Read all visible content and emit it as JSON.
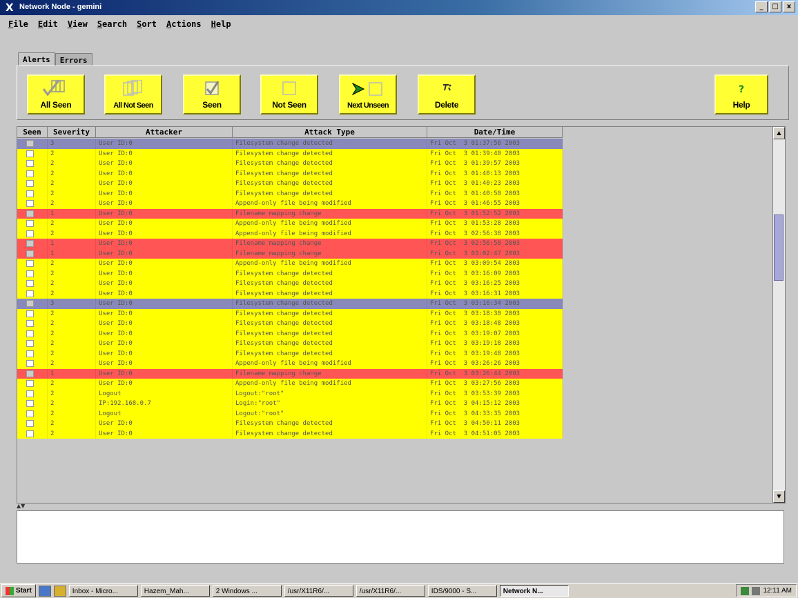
{
  "window": {
    "title": "Network Node - gemini",
    "controls": [
      "_",
      "□",
      "x"
    ]
  },
  "menu": [
    {
      "first": "F",
      "rest": "ile"
    },
    {
      "first": "E",
      "rest": "dit"
    },
    {
      "first": "V",
      "rest": "iew"
    },
    {
      "first": "S",
      "rest": "earch"
    },
    {
      "first": "S",
      "rest": "ort"
    },
    {
      "first": "A",
      "rest": "ctions"
    },
    {
      "first": "H",
      "rest": "elp"
    }
  ],
  "tabs": {
    "alerts": "Alerts",
    "errors": "Errors"
  },
  "toolbar": {
    "all_seen": "All Seen",
    "all_not_seen": "All Not Seen",
    "seen": "Seen",
    "not_seen": "Not Seen",
    "next_unseen": "Next Unseen",
    "delete": "Delete",
    "help": "Help"
  },
  "columns": {
    "seen": "Seen",
    "severity": "Severity",
    "attacker": "Attacker",
    "attack_type": "Attack Type",
    "datetime": "Date/Time"
  },
  "rows": [
    {
      "sev": "3",
      "attacker": "User ID:0",
      "type": "Filesystem change detected",
      "time": "Fri Oct  3 01:37:56 2003"
    },
    {
      "sev": "2",
      "attacker": "User ID:0",
      "type": "Filesystem change detected",
      "time": "Fri Oct  3 01:39:40 2003"
    },
    {
      "sev": "2",
      "attacker": "User ID:0",
      "type": "Filesystem change detected",
      "time": "Fri Oct  3 01:39:57 2003"
    },
    {
      "sev": "2",
      "attacker": "User ID:0",
      "type": "Filesystem change detected",
      "time": "Fri Oct  3 01:40:13 2003"
    },
    {
      "sev": "2",
      "attacker": "User ID:0",
      "type": "Filesystem change detected",
      "time": "Fri Oct  3 01:40:23 2003"
    },
    {
      "sev": "2",
      "attacker": "User ID:0",
      "type": "Filesystem change detected",
      "time": "Fri Oct  3 01:40:50 2003"
    },
    {
      "sev": "2",
      "attacker": "User ID:0",
      "type": "Append-only file being modified",
      "time": "Fri Oct  3 01:46:55 2003"
    },
    {
      "sev": "1",
      "attacker": "User ID:0",
      "type": "Filename mapping change",
      "time": "Fri Oct  3 01:52:52 2003"
    },
    {
      "sev": "2",
      "attacker": "User ID:0",
      "type": "Append-only file being modified",
      "time": "Fri Oct  3 01:53:28 2003"
    },
    {
      "sev": "2",
      "attacker": "User ID:0",
      "type": "Append-only file being modified",
      "time": "Fri Oct  3 02:56:38 2003"
    },
    {
      "sev": "1",
      "attacker": "User ID:0",
      "type": "Filename mapping change",
      "time": "Fri Oct  3 02:56:58 2003"
    },
    {
      "sev": "1",
      "attacker": "User ID:0",
      "type": "Filename mapping change",
      "time": "Fri Oct  3 03:02:47 2003"
    },
    {
      "sev": "2",
      "attacker": "User ID:0",
      "type": "Append-only file being modified",
      "time": "Fri Oct  3 03:09:54 2003"
    },
    {
      "sev": "2",
      "attacker": "User ID:0",
      "type": "Filesystem change detected",
      "time": "Fri Oct  3 03:16:09 2003"
    },
    {
      "sev": "2",
      "attacker": "User ID:0",
      "type": "Filesystem change detected",
      "time": "Fri Oct  3 03:16:25 2003"
    },
    {
      "sev": "2",
      "attacker": "User ID:0",
      "type": "Filesystem change detected",
      "time": "Fri Oct  3 03:16:31 2003"
    },
    {
      "sev": "3",
      "attacker": "User ID:0",
      "type": "Filesystem change detected",
      "time": "Fri Oct  3 03:16:34 2003"
    },
    {
      "sev": "2",
      "attacker": "User ID:0",
      "type": "Filesystem change detected",
      "time": "Fri Oct  3 03:18:30 2003"
    },
    {
      "sev": "2",
      "attacker": "User ID:0",
      "type": "Filesystem change detected",
      "time": "Fri Oct  3 03:18:48 2003"
    },
    {
      "sev": "2",
      "attacker": "User ID:0",
      "type": "Filesystem change detected",
      "time": "Fri Oct  3 03:19:07 2003"
    },
    {
      "sev": "2",
      "attacker": "User ID:0",
      "type": "Filesystem change detected",
      "time": "Fri Oct  3 03:19:18 2003"
    },
    {
      "sev": "2",
      "attacker": "User ID:0",
      "type": "Filesystem change detected",
      "time": "Fri Oct  3 03:19:48 2003"
    },
    {
      "sev": "2",
      "attacker": "User ID:0",
      "type": "Append-only file being modified",
      "time": "Fri Oct  3 03:26:26 2003"
    },
    {
      "sev": "1",
      "attacker": "User ID:0",
      "type": "Filename mapping change",
      "time": "Fri Oct  3 03:26:44 2003"
    },
    {
      "sev": "2",
      "attacker": "User ID:0",
      "type": "Append-only file being modified",
      "time": "Fri Oct  3 03:27:56 2003"
    },
    {
      "sev": "2",
      "attacker": "Logout",
      "type": "Logout:\"root\"",
      "time": "Fri Oct  3 03:53:39 2003"
    },
    {
      "sev": "2",
      "attacker": "IP:192.168.0.7",
      "type": "Login:\"root\"",
      "time": "Fri Oct  3 04:15:12 2003"
    },
    {
      "sev": "2",
      "attacker": "Logout",
      "type": "Logout:\"root\"",
      "time": "Fri Oct  3 04:33:35 2003"
    },
    {
      "sev": "2",
      "attacker": "User ID:0",
      "type": "Filesystem change detected",
      "time": "Fri Oct  3 04:50:11 2003"
    },
    {
      "sev": "2",
      "attacker": "User ID:0",
      "type": "Filesystem change detected",
      "time": "Fri Oct  3 04:51:05 2003"
    }
  ],
  "taskbar": {
    "start": "Start",
    "items": [
      "Inbox - Micro...",
      "Hazem_Mah...",
      "2 Windows ...",
      "/usr/X11R6/...",
      "/usr/X11R6/...",
      "IDS/9000 - S...",
      "Network N..."
    ],
    "clock": "12:11 AM"
  },
  "colors": {
    "sev1": "#ff5555",
    "sev2": "#ffff00",
    "sev3": "#8888bb",
    "button": "#ffff33",
    "titlebar": "#0a246a"
  }
}
